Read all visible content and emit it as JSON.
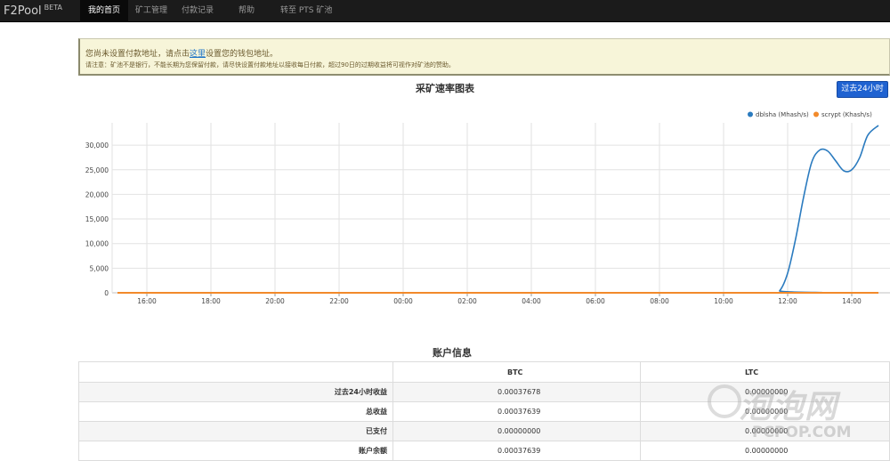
{
  "navbar": {
    "brand": "F2Pool",
    "brand_sup": "BETA",
    "items": [
      "我的首页",
      "矿工管理",
      "付款记录",
      "帮助",
      "转至 PTS 矿池"
    ]
  },
  "alert": {
    "line1_before": "您尚未设置付款地址，请点击",
    "line1_link": "这里",
    "line1_after": "设置您的钱包地址。",
    "line2": "请注意：矿池不是银行，不能长期为您保留付款，请尽快设置付款地址以接收每日付款，超过90日的过期收益将可视作对矿池的赞助。"
  },
  "chart_section": {
    "title": "采矿速率图表",
    "range_button": "过去24小时"
  },
  "chart_data": {
    "type": "line",
    "legend_position": "top-right",
    "grid": true,
    "ylim": [
      0,
      34000
    ],
    "yticks": [
      "0",
      "5,000",
      "10,000",
      "15,000",
      "20,000",
      "25,000",
      "30,000"
    ],
    "xticks": [
      "16:00",
      "18:00",
      "20:00",
      "22:00",
      "00:00",
      "02:00",
      "04:00",
      "06:00",
      "08:00",
      "10:00",
      "12:00",
      "14:00"
    ],
    "series": [
      {
        "name": "dblsha (Mhash/s)",
        "color": "#2b7bbf",
        "points": [
          [
            "15:05",
            0
          ],
          [
            "11:30",
            0
          ],
          [
            "11:45",
            400
          ],
          [
            "12:00",
            4000
          ],
          [
            "12:15",
            11000
          ],
          [
            "12:30",
            19500
          ],
          [
            "12:45",
            26500
          ],
          [
            "13:00",
            29000
          ],
          [
            "13:15",
            28800
          ],
          [
            "13:30",
            26800
          ],
          [
            "13:45",
            24800
          ],
          [
            "14:00",
            25000
          ],
          [
            "14:15",
            27500
          ],
          [
            "14:30",
            32000
          ],
          [
            "14:50",
            34000
          ]
        ]
      },
      {
        "name": "scrypt (Khash/s)",
        "color": "#f28a2b",
        "points": [
          [
            "15:05",
            0
          ],
          [
            "14:50",
            0
          ]
        ]
      }
    ]
  },
  "account": {
    "title": "账户信息",
    "columns": [
      "BTC",
      "LTC"
    ],
    "rows": [
      {
        "label": "过去24小时收益",
        "btc": "0.00037678",
        "ltc": "0.00000000"
      },
      {
        "label": "总收益",
        "btc": "0.00037639",
        "ltc": "0.00000000"
      },
      {
        "label": "已支付",
        "btc": "0.00000000",
        "ltc": "0.00000000"
      },
      {
        "label": "账户余额",
        "btc": "0.00037639",
        "ltc": "0.00000000"
      }
    ]
  },
  "watermark": {
    "text_cn": "泡泡网",
    "text_en": "PCPOP.COM"
  }
}
